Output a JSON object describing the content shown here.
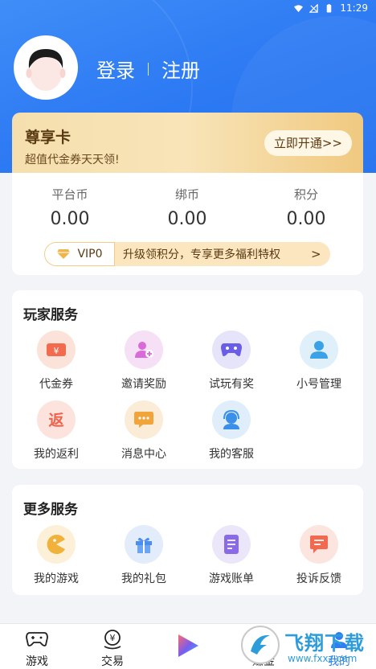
{
  "status_bar": {
    "time": "11:29"
  },
  "auth": {
    "login": "登录",
    "register": "注册"
  },
  "vip_card": {
    "title": "尊享卡",
    "subtitle": "超值代金券天天领!",
    "button": "立即开通>>"
  },
  "wallet": {
    "items": [
      {
        "label": "平台币",
        "value": "0.00"
      },
      {
        "label": "绑币",
        "value": "0.00"
      },
      {
        "label": "积分",
        "value": "0.00"
      }
    ],
    "vip_bar": {
      "level": "VIP0",
      "text": "升级领积分，专享更多福利特权",
      "arrow": ">"
    }
  },
  "player_services": {
    "title": "玩家服务",
    "items": [
      {
        "label": "代金券",
        "icon": "voucher-icon",
        "color": "#fbe3da"
      },
      {
        "label": "邀请奖励",
        "icon": "invite-icon",
        "color": "#f6e0f6"
      },
      {
        "label": "试玩有奖",
        "icon": "gamepad-icon",
        "color": "#e6e4fb"
      },
      {
        "label": "小号管理",
        "icon": "user-icon",
        "color": "#dff0fb"
      },
      {
        "label": "我的返利",
        "icon": "rebate-icon",
        "color": "#fde3de"
      },
      {
        "label": "消息中心",
        "icon": "message-icon",
        "color": "#fbecd8"
      },
      {
        "label": "我的客服",
        "icon": "customer-service-icon",
        "color": "#e0eefb"
      }
    ]
  },
  "more_services": {
    "title": "更多服务",
    "items": [
      {
        "label": "我的游戏",
        "icon": "my-games-icon",
        "color": "#fdf0d8"
      },
      {
        "label": "我的礼包",
        "icon": "gift-icon",
        "color": "#e3ecfb"
      },
      {
        "label": "游戏账单",
        "icon": "bill-icon",
        "color": "#ece6fb"
      },
      {
        "label": "投诉反馈",
        "icon": "feedback-icon",
        "color": "#fde5df"
      }
    ]
  },
  "tabbar": {
    "items": [
      {
        "label": "游戏",
        "icon": "gamepad-tab-icon"
      },
      {
        "label": "交易",
        "icon": "trade-icon"
      },
      {
        "label": "",
        "icon": "play-icon"
      },
      {
        "label": "赚金",
        "icon": "earn-icon"
      },
      {
        "label": "我的",
        "icon": "profile-icon"
      }
    ]
  },
  "watermark": {
    "title": "飞翔下载",
    "url": "www.fxxz.com"
  }
}
